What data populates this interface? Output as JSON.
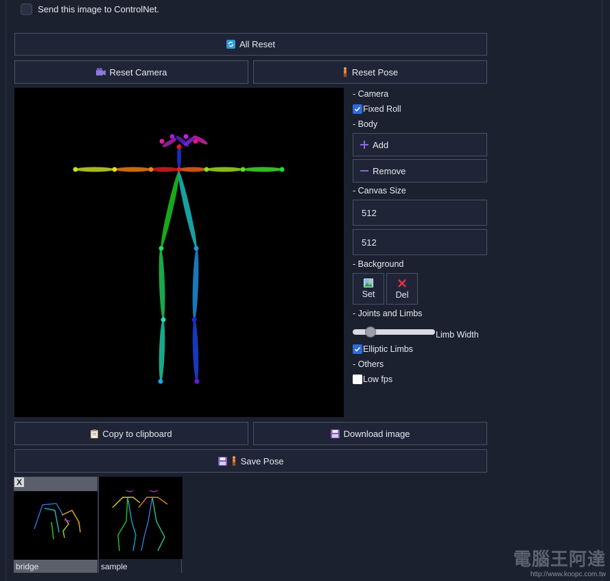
{
  "top": {
    "send_label": "Send this image to ControlNet."
  },
  "buttons": {
    "all_reset": "All Reset",
    "reset_camera": "Reset Camera",
    "reset_pose": "Reset Pose",
    "copy_clipboard": "Copy to clipboard",
    "download_image": "Download image",
    "save_pose": "Save Pose"
  },
  "panel": {
    "camera_label": "- Camera",
    "fixed_roll_label": "Fixed Roll",
    "fixed_roll_checked": true,
    "body_label": "- Body",
    "add_label": "Add",
    "remove_label": "Remove",
    "canvas_size_label": "- Canvas Size",
    "width_value": "512",
    "height_value": "512",
    "background_label": "- Background",
    "set_label": "Set",
    "del_label": "Del",
    "joints_label": "- Joints and Limbs",
    "limb_width_label": "Limb Width",
    "limb_width_fraction": 0.15,
    "elliptic_label": "Elliptic Limbs",
    "elliptic_checked": true,
    "others_label": "- Others",
    "low_fps_label": "Low fps",
    "low_fps_checked": false
  },
  "gallery": [
    {
      "caption": "bridge"
    },
    {
      "caption": "sample"
    }
  ],
  "watermark": {
    "title": "電腦王阿達",
    "url": "http://www.koopc.com.tw"
  },
  "colors": {
    "accent": "#2f6ad9",
    "bg": "#1c2130",
    "border": "#4a5266"
  }
}
